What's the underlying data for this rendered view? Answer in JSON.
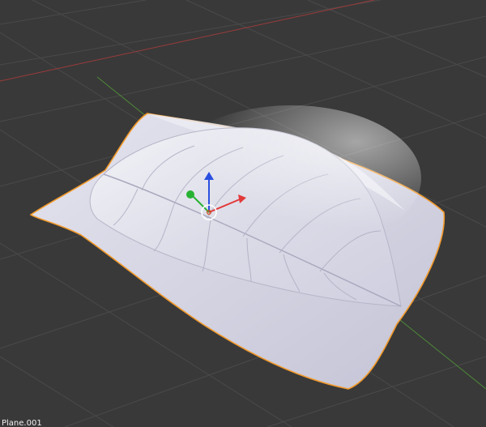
{
  "viewport": {
    "background": "#393939",
    "grid_color": "#4a4a4a",
    "x_axis_color": "#9b3b3b",
    "y_axis_color": "#4e8a37"
  },
  "object": {
    "name": "Plane.001",
    "selection_outline_color": "#f39a2b",
    "surface_color": "#d9d9e6"
  },
  "gizmo": {
    "x_arrow_color": "#e23a3a",
    "y_arrow_color": "#27b233",
    "z_arrow_color": "#2a4fe0",
    "pivot_icon": "origin-circle-icon"
  }
}
